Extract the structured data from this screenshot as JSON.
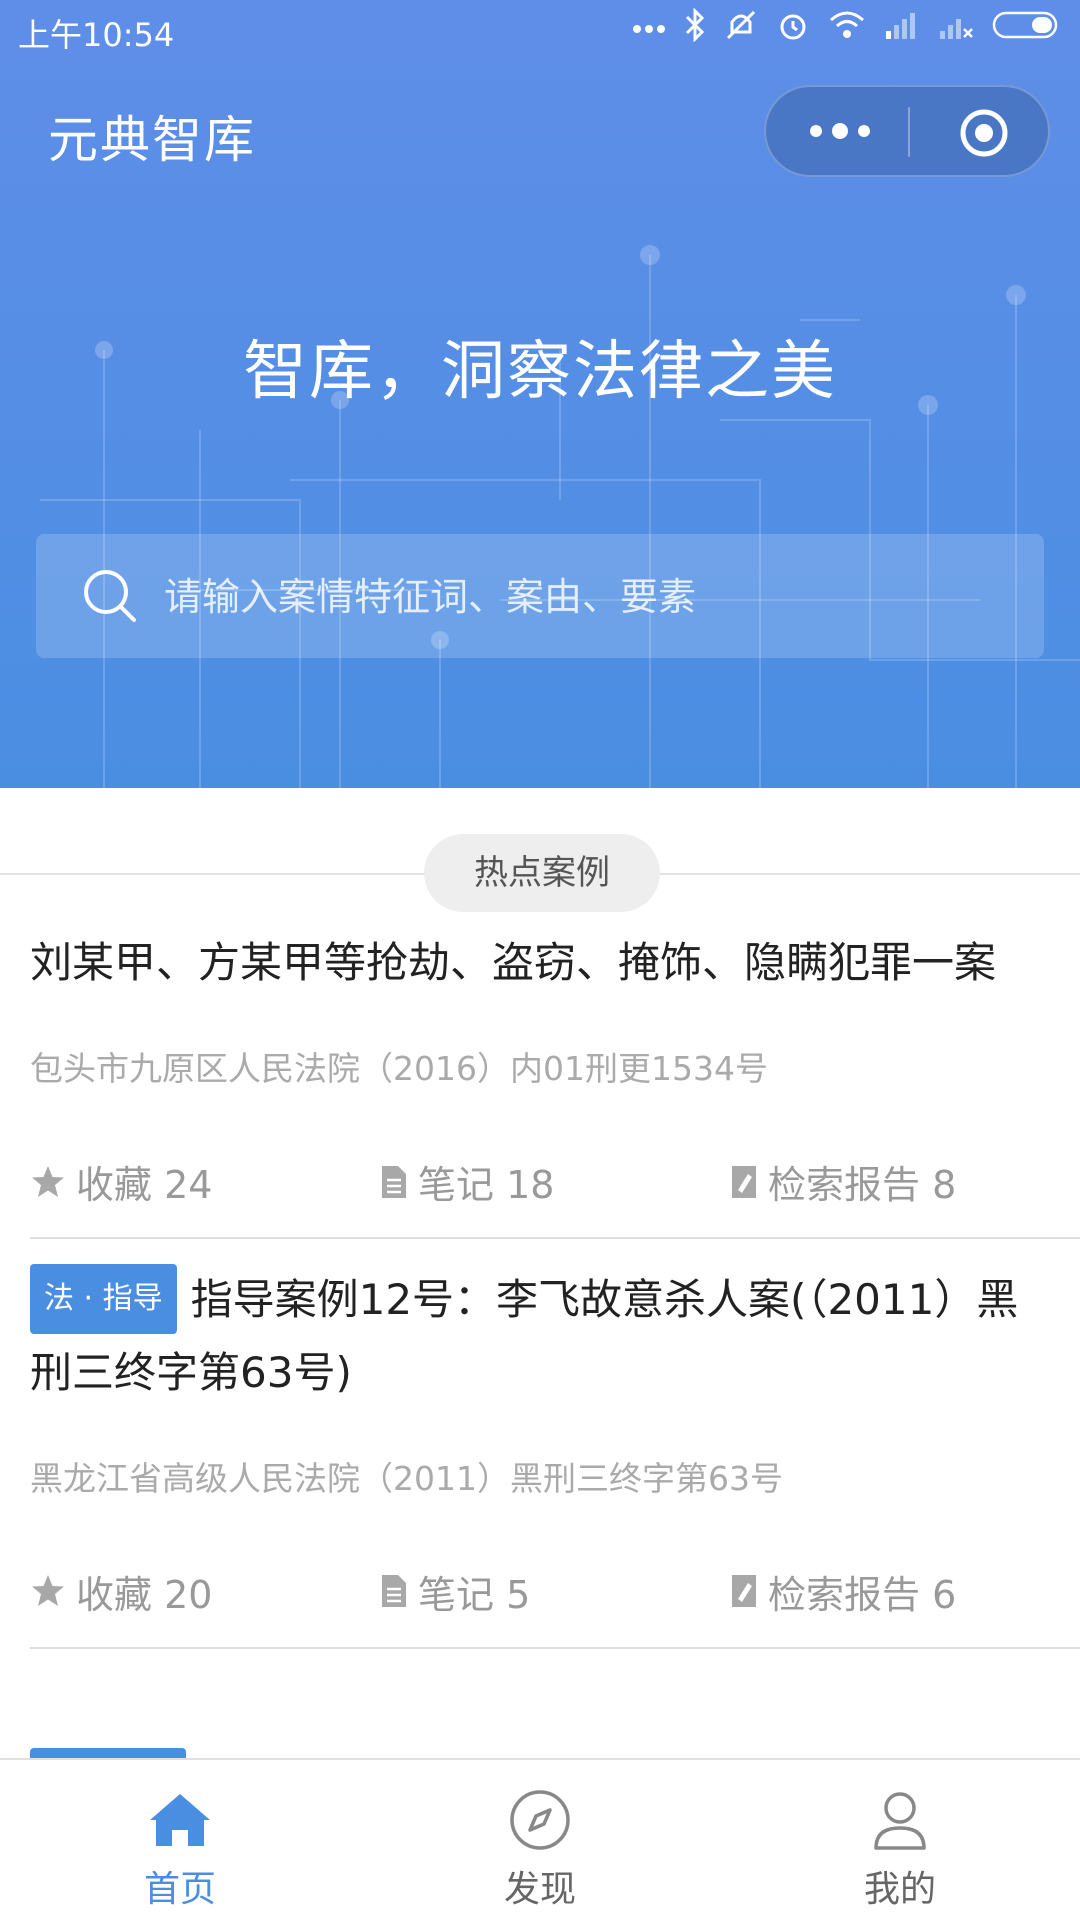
{
  "status_bar": {
    "time": "上午10:54"
  },
  "header": {
    "app_title": "元典智库",
    "more_icon": "more-dots-icon",
    "close_icon": "target-close-icon"
  },
  "hero": {
    "slogan": "智库，洞察法律之美"
  },
  "search": {
    "placeholder": "请输入案情特征词、案由、要素",
    "icon": "search-icon"
  },
  "section": {
    "title": "热点案例"
  },
  "cases": [
    {
      "tag": "",
      "title": "刘某甲、方某甲等抢劫、盗窃、掩饰、隐瞒犯罪一案",
      "court": "包头市九原区人民法院（2016）内01刑更1534号",
      "favorites_label": "收藏 24",
      "notes_label": "笔记 18",
      "reports_label": "检索报告 8"
    },
    {
      "tag": "法 · 指导",
      "title": "指导案例12号：李飞故意杀人案(（2011）黑刑三终字第63号)",
      "court": "黑龙江省高级人民法院（2011）黑刑三终字第63号",
      "favorites_label": "收藏 20",
      "notes_label": "笔记 5",
      "reports_label": "检索报告 6"
    }
  ],
  "tabbar": {
    "items": [
      {
        "label": "首页",
        "icon": "home-icon",
        "active": true
      },
      {
        "label": "发现",
        "icon": "compass-icon",
        "active": false
      },
      {
        "label": "我的",
        "icon": "user-icon",
        "active": false
      }
    ]
  },
  "colors": {
    "primary": "#4a8ee2",
    "hero_top": "#5f8ee8",
    "text_dark": "#222222",
    "text_muted": "#aaaaaa"
  }
}
